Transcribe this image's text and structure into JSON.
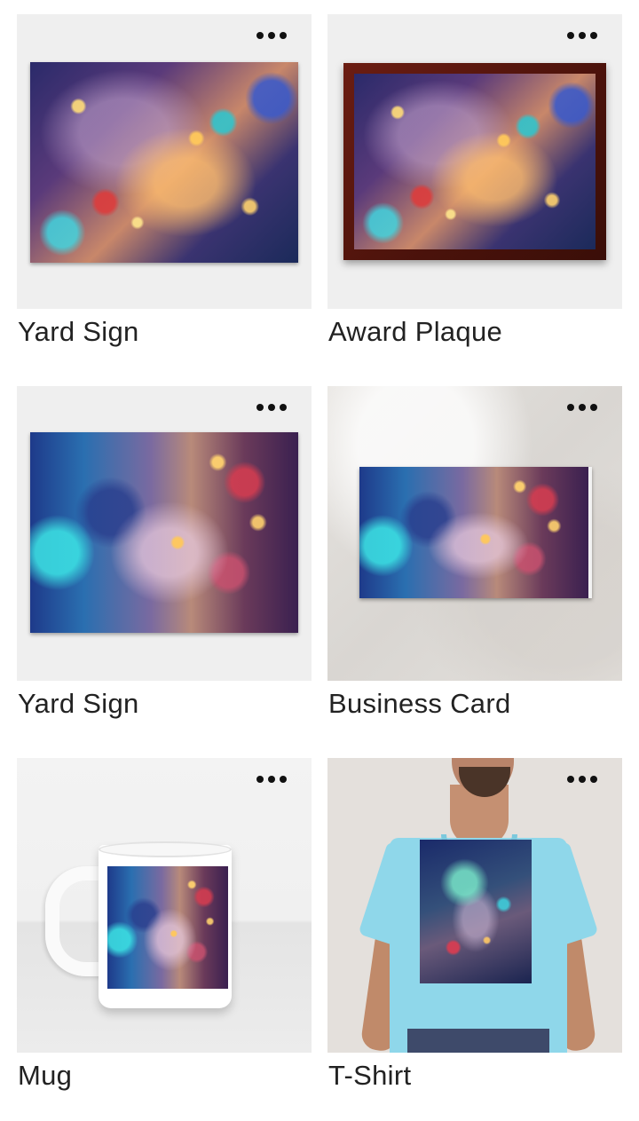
{
  "products": [
    {
      "label": "Yard Sign",
      "more_icon": "more-horizontal-icon"
    },
    {
      "label": "Award Plaque",
      "more_icon": "more-horizontal-icon"
    },
    {
      "label": "Yard Sign",
      "more_icon": "more-horizontal-icon"
    },
    {
      "label": "Business Card",
      "more_icon": "more-horizontal-icon"
    },
    {
      "label": "Mug",
      "more_icon": "more-horizontal-icon"
    },
    {
      "label": "T-Shirt",
      "more_icon": "more-horizontal-icon"
    }
  ],
  "colors": {
    "tile_background": "#efefef",
    "label_text": "#222222",
    "tshirt_color": "#8fd7ea",
    "plaque_frame": "#5a160e"
  }
}
